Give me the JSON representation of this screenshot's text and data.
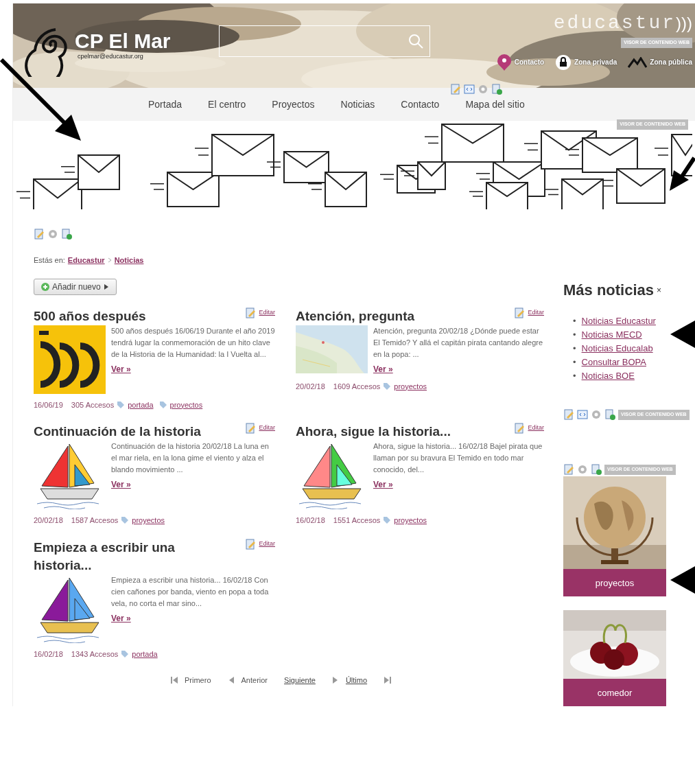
{
  "header": {
    "site_name": "CP El Mar",
    "email": "cpelmar@educastur.org",
    "brand": "educastur",
    "brand_mark": ")))",
    "label": "VISOR DE CONTENIDO WEB",
    "links": [
      {
        "label": "Contacto",
        "kind": "pin"
      },
      {
        "label": "Zona privada",
        "kind": "lock"
      },
      {
        "label": "Zona pública",
        "kind": "peaks"
      }
    ]
  },
  "nav": [
    "Portada",
    "El centro",
    "Proyectos",
    "Noticias",
    "Contacto",
    "Mapa del sitio"
  ],
  "banner_label": "VISOR DE CONTENIDO WEB",
  "breadcrumb": {
    "prefix": "Estás en:",
    "items": [
      "Educastur",
      "Noticias"
    ]
  },
  "add_button": "Añadir nuevo",
  "news": [
    {
      "title": "500 años después",
      "edit": "Editar",
      "excerpt": "500 años después 16/06/19 Durante el año 2019 tendrá lugar la conmemoración de un hito clave de la Historia de la Humanidad: la I Vuelta al...",
      "more": "Ver »",
      "date": "16/06/19",
      "accesses": "305 Accesos",
      "tags": [
        "portada",
        "proyectos"
      ]
    },
    {
      "title": "Atención, pregunta",
      "edit": "Editar",
      "excerpt": "Atención, pregunta 20/02/18 ¿Dónde puede estar El Temido?  Y allá el capitán pirata cantando alegre en la popa: ...",
      "more": "Ver »",
      "date": "20/02/18",
      "accesses": "1609 Accesos",
      "tags": [
        "proyectos"
      ]
    },
    {
      "title": "Continuación de la historia",
      "edit": "Editar",
      "excerpt": "Continuación de la historia 20/02/18  La luna en el mar riela, en la lona gime el viento y alza el blando movimiento ...",
      "more": "Ver »",
      "date": "20/02/18",
      "accesses": "1587 Accesos",
      "tags": [
        "proyectos"
      ]
    },
    {
      "title": "Ahora, sigue la historia...",
      "edit": "Editar",
      "excerpt": "Ahora, sigue la historia... 16/02/18  Bajel pirata que llaman por su bravura El Temido en todo mar conocido, del...",
      "more": "Ver »",
      "date": "16/02/18",
      "accesses": "1551 Accesos",
      "tags": [
        "proyectos"
      ]
    },
    {
      "title": "Empieza a escribir una historia...",
      "edit": "Editar",
      "excerpt": "Empieza a escribir una historia... 16/02/18  Con cien cañones por banda, viento en popa a toda vela, no corta el mar sino...",
      "more": "Ver »",
      "date": "16/02/18",
      "accesses": "1343 Accesos",
      "tags": [
        "portada"
      ]
    }
  ],
  "pagination": [
    {
      "label": "Primero",
      "kind": "first",
      "disabled": true
    },
    {
      "label": "Anterior",
      "kind": "prev",
      "disabled": true
    },
    {
      "label": "Siguiente",
      "kind": "next",
      "disabled": false
    },
    {
      "label": "Último",
      "kind": "last",
      "disabled": false
    }
  ],
  "sidebar": {
    "title": "Más noticias",
    "close": "×",
    "bullet": "•",
    "links": [
      "Noticias Educastur",
      "Noticias MECD",
      "Noticias Educalab",
      "Consultar BOPA",
      "Noticias BOE"
    ],
    "labels": [
      "VISOR DE CONTENIDO WEB",
      "VISOR DE CONTENIDO WEB"
    ],
    "cards": [
      {
        "caption": "proyectos"
      },
      {
        "caption": "comedor"
      }
    ]
  }
}
